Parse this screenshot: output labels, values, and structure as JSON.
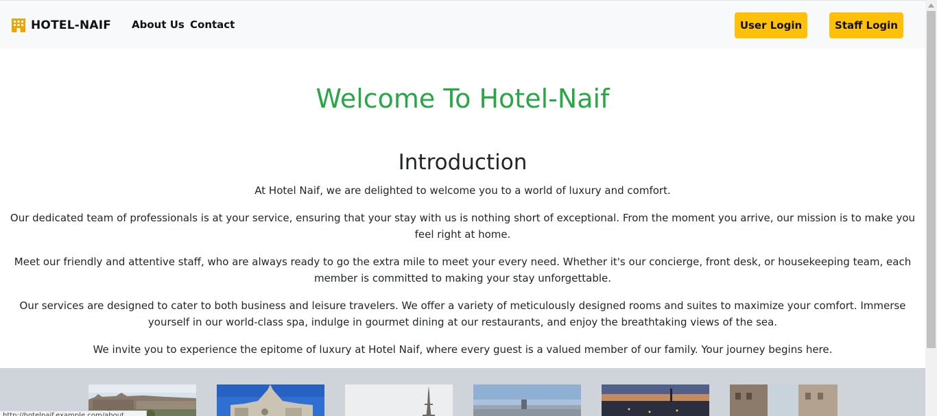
{
  "navbar": {
    "brand": "HOTEL-NAIF",
    "brand_icon": "hotel-icon",
    "links": {
      "about": "About Us",
      "contact": "Contact"
    },
    "buttons": {
      "user_login": "User Login",
      "staff_login": "Staff Login"
    }
  },
  "main": {
    "welcome": "Welcome To Hotel-Naif",
    "intro_title": "Introduction",
    "paragraphs": [
      "At Hotel Naif, we are delighted to welcome you to a world of luxury and comfort.",
      "Our dedicated team of professionals is at your service, ensuring that your stay with us is nothing short of exceptional. From the moment you arrive, our mission is to make you feel right at home.",
      "Meet our friendly and attentive staff, who are always ready to go the extra mile to meet your every need. Whether it's our concierge, front desk, or housekeeping team, each member is committed to making your stay unforgettable.",
      "Our services are designed to cater to both business and leisure travelers. We offer a variety of meticulously designed rooms and suites to maximize your comfort. Immerse yourself in our world-class spa, indulge in gourmet dining at our restaurants, and enjoy the breathtaking views of the sea.",
      "We invite you to experience the epitome of luxury at Hotel Naif, where every guest is a valued member of our family. Your journey begins here."
    ]
  },
  "status_bar": {
    "url": "http://hotelnaif.example.com/about"
  },
  "colors": {
    "accent_green": "#28a745",
    "button_yellow": "#ffc107",
    "navbar_bg": "#f8f9fa",
    "gallery_bg": "#ced4da"
  }
}
